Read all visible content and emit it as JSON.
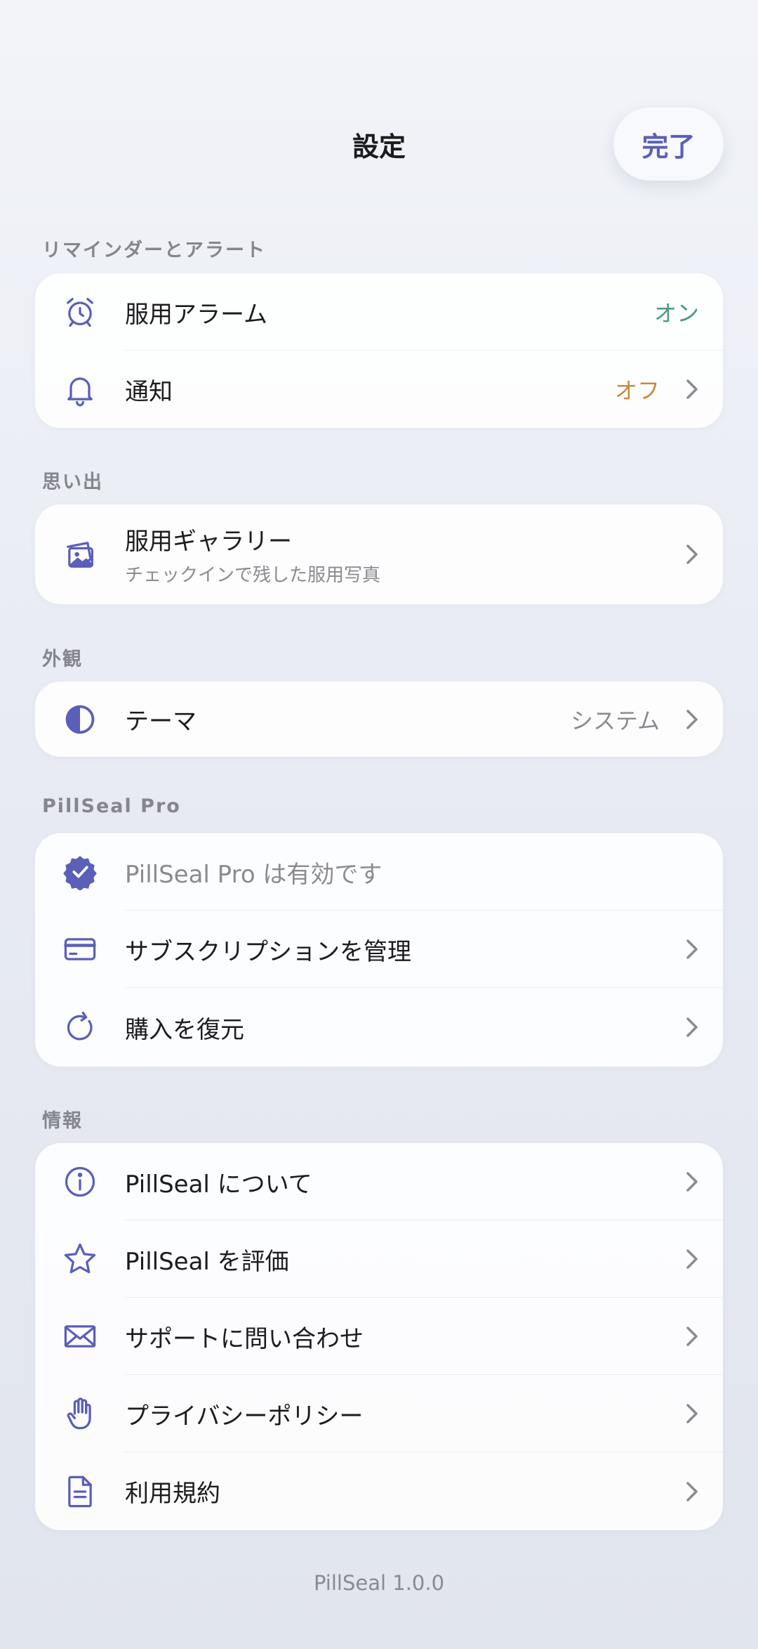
{
  "header": {
    "title": "設定",
    "done_label": "完了"
  },
  "colors": {
    "accent": "#5a5fb8",
    "status_on": "#4a9a80",
    "status_off": "#c98a3a"
  },
  "sections": {
    "reminders": {
      "label": "リマインダーとアラート",
      "items": [
        {
          "label": "服用アラーム",
          "value": "オン",
          "icon": "alarm-clock-icon"
        },
        {
          "label": "通知",
          "value": "オフ",
          "icon": "bell-icon"
        }
      ]
    },
    "memories": {
      "label": "思い出",
      "items": [
        {
          "label": "服用ギャラリー",
          "sub": "チェックインで残した服用写真",
          "icon": "photo-gallery-icon"
        }
      ]
    },
    "appearance": {
      "label": "外観",
      "items": [
        {
          "label": "テーマ",
          "value": "システム",
          "icon": "half-circle-theme-icon"
        }
      ]
    },
    "pro": {
      "label": "PillSeal Pro",
      "items": [
        {
          "label": "PillSeal Pro は有効です",
          "icon": "verified-badge-icon"
        },
        {
          "label": "サブスクリプションを管理",
          "icon": "credit-card-icon"
        },
        {
          "label": "購入を復元",
          "icon": "restore-icon"
        }
      ]
    },
    "info": {
      "label": "情報",
      "items": [
        {
          "label": "PillSeal について",
          "icon": "info-icon"
        },
        {
          "label": "PillSeal を評価",
          "icon": "star-icon"
        },
        {
          "label": "サポートに問い合わせ",
          "icon": "envelope-icon"
        },
        {
          "label": "プライバシーポリシー",
          "icon": "hand-icon"
        },
        {
          "label": "利用規約",
          "icon": "document-icon"
        }
      ]
    }
  },
  "footer": {
    "version": "PillSeal 1.0.0"
  }
}
